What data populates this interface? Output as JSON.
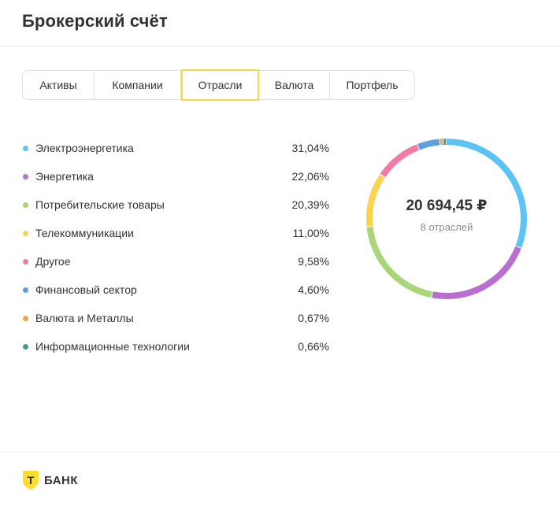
{
  "header": {
    "title": "Брокерский счёт"
  },
  "tabs": [
    {
      "label": "Активы",
      "active": false
    },
    {
      "label": "Компании",
      "active": false
    },
    {
      "label": "Отрасли",
      "active": true
    },
    {
      "label": "Валюта",
      "active": false
    },
    {
      "label": "Портфель",
      "active": false
    }
  ],
  "colors": {
    "accent": "#f5d94a",
    "ring_track": "#eef0f3"
  },
  "legend": [
    {
      "name": "Электроэнергетика",
      "value": "31,04%",
      "color": "#5bc3f5"
    },
    {
      "name": "Энергетика",
      "value": "22,06%",
      "color": "#b86fd0"
    },
    {
      "name": "Потребительские товары",
      "value": "20,39%",
      "color": "#aad67a"
    },
    {
      "name": "Телекоммуникации",
      "value": "11,00%",
      "color": "#fbd34e"
    },
    {
      "name": "Другое",
      "value": "9,58%",
      "color": "#f47aa6"
    },
    {
      "name": "Финансовый сектор",
      "value": "4,60%",
      "color": "#5f9fdf"
    },
    {
      "name": "Валюта и Металлы",
      "value": "0,67%",
      "color": "#f3a14a"
    },
    {
      "name": "Информационные технологии",
      "value": "0,66%",
      "color": "#3e9e87"
    }
  ],
  "chart_data": {
    "type": "pie",
    "categories": [
      "Электроэнергетика",
      "Энергетика",
      "Потребительские товары",
      "Телекоммуникации",
      "Другое",
      "Финансовый сектор",
      "Валюта и Металлы",
      "Информационные технологии"
    ],
    "values": [
      31.04,
      22.06,
      20.39,
      11.0,
      9.58,
      4.6,
      0.67,
      0.66
    ],
    "colors": [
      "#5bc3f5",
      "#b86fd0",
      "#aad67a",
      "#fbd34e",
      "#f47aa6",
      "#5f9fdf",
      "#f3a14a",
      "#3e9e87"
    ]
  },
  "summary": {
    "total": "20 694,45 ₽",
    "count_label": "8 отраслей"
  },
  "footer": {
    "logo_letter": "Т",
    "logo_text": "БАНК"
  }
}
